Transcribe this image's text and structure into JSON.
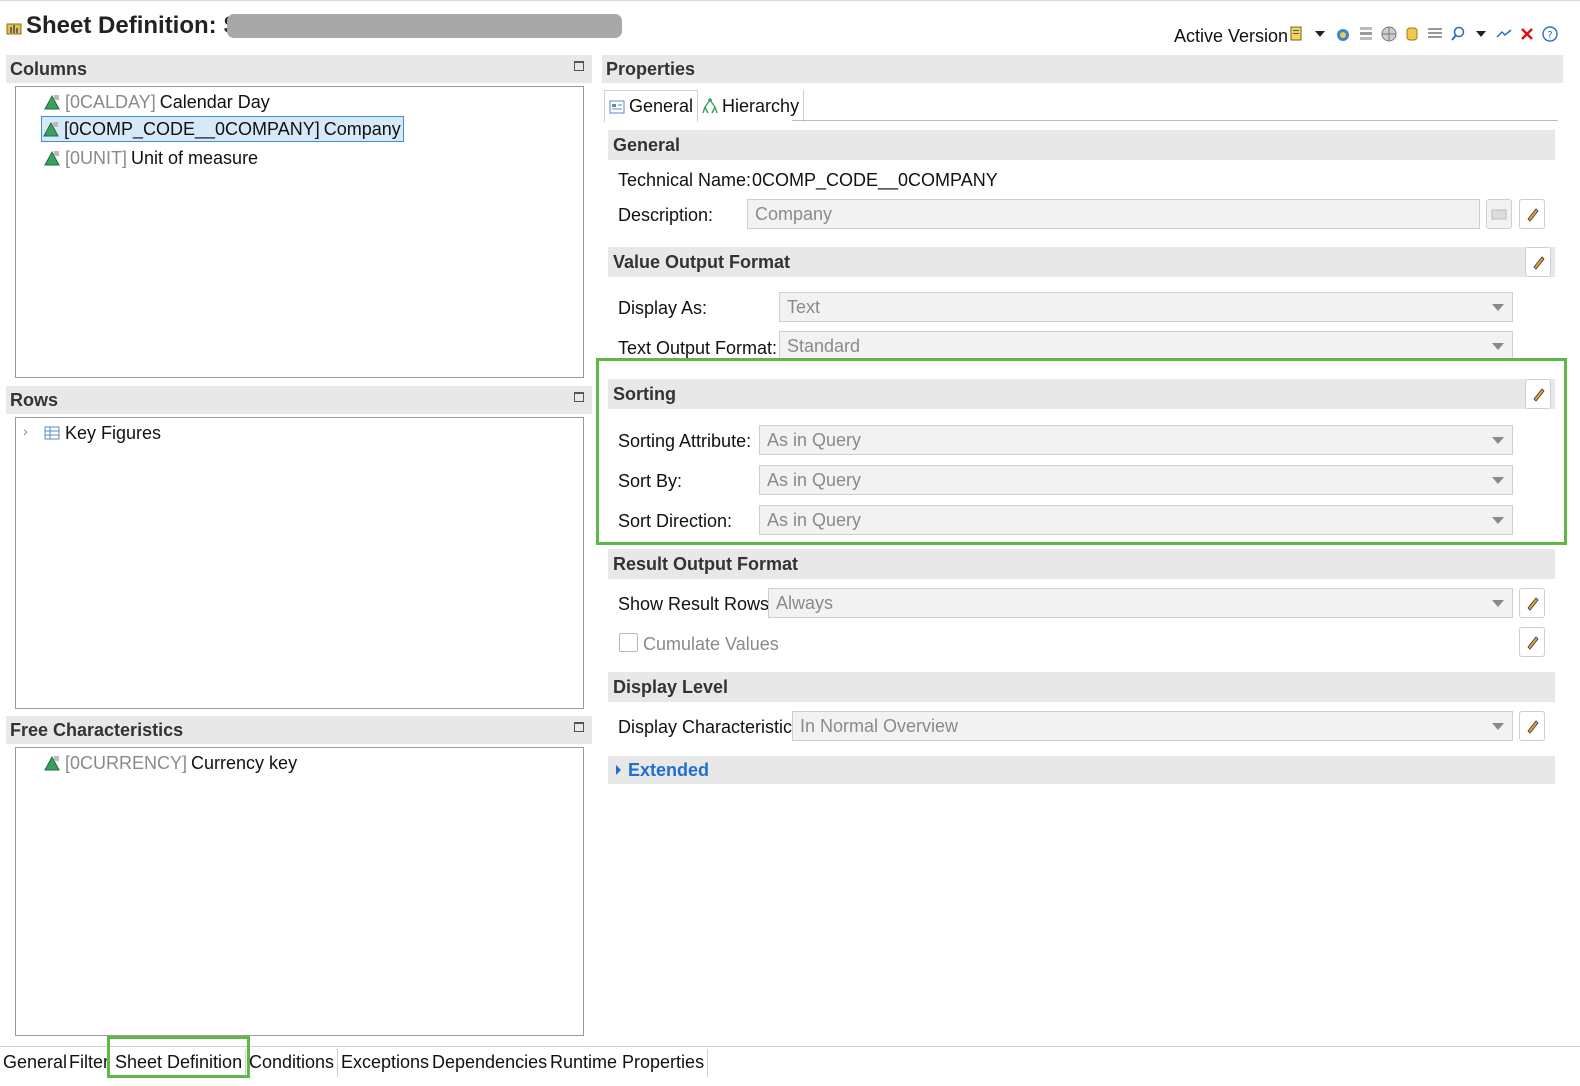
{
  "title": {
    "text": "Sheet Definition: S",
    "active_version": "Active Version"
  },
  "toolbar": {
    "icons": [
      "document-icon",
      "dropdown-arrow-icon",
      "refresh-icon",
      "stack-icon",
      "globe-icon",
      "cylinder-icon",
      "list-icon",
      "search-icon",
      "dropdown-arrow-icon",
      "link-icon",
      "close-icon",
      "help-icon"
    ]
  },
  "columns": {
    "header": "Columns",
    "items": [
      {
        "tech": "[0CALDAY]",
        "name": "Calendar Day"
      },
      {
        "tech": "[0COMP_CODE__0COMPANY]",
        "name": "Company"
      },
      {
        "tech": "[0UNIT]",
        "name": "Unit of measure"
      }
    ]
  },
  "rows": {
    "header": "Rows",
    "items": [
      {
        "name": "Key Figures"
      }
    ]
  },
  "free": {
    "header": "Free Characteristics",
    "items": [
      {
        "tech": "[0CURRENCY]",
        "name": "Currency key"
      }
    ]
  },
  "properties": {
    "header": "Properties",
    "tabs": [
      "General",
      "Hierarchy"
    ],
    "general": {
      "header": "General",
      "technical_name_label": "Technical Name:",
      "technical_name_value": "0COMP_CODE__0COMPANY",
      "description_label": "Description:",
      "description_value": "Company"
    },
    "value_output": {
      "header": "Value Output Format",
      "display_as_label": "Display As:",
      "display_as_value": "Text",
      "text_output_label": "Text Output Format:",
      "text_output_value": "Standard"
    },
    "sorting": {
      "header": "Sorting",
      "attribute_label": "Sorting Attribute:",
      "attribute_value": "As in Query",
      "sort_by_label": "Sort By:",
      "sort_by_value": "As in Query",
      "direction_label": "Sort Direction:",
      "direction_value": "As in Query"
    },
    "result_output": {
      "header": "Result Output Format",
      "show_rows_label": "Show Result Rows:",
      "show_rows_value": "Always",
      "cumulate_label": "Cumulate Values"
    },
    "display_level": {
      "header": "Display Level",
      "char_label": "Display Characteristic:",
      "char_value": "In Normal Overview"
    },
    "extended": "Extended"
  },
  "bottom_tabs": [
    "General",
    "Filter",
    "Sheet Definition",
    "Conditions",
    "Exceptions",
    "Dependencies",
    "Runtime Properties"
  ],
  "colors": {
    "highlight": "#5cb946",
    "selection": "#d7e9f8",
    "link": "#1f6fd0"
  }
}
